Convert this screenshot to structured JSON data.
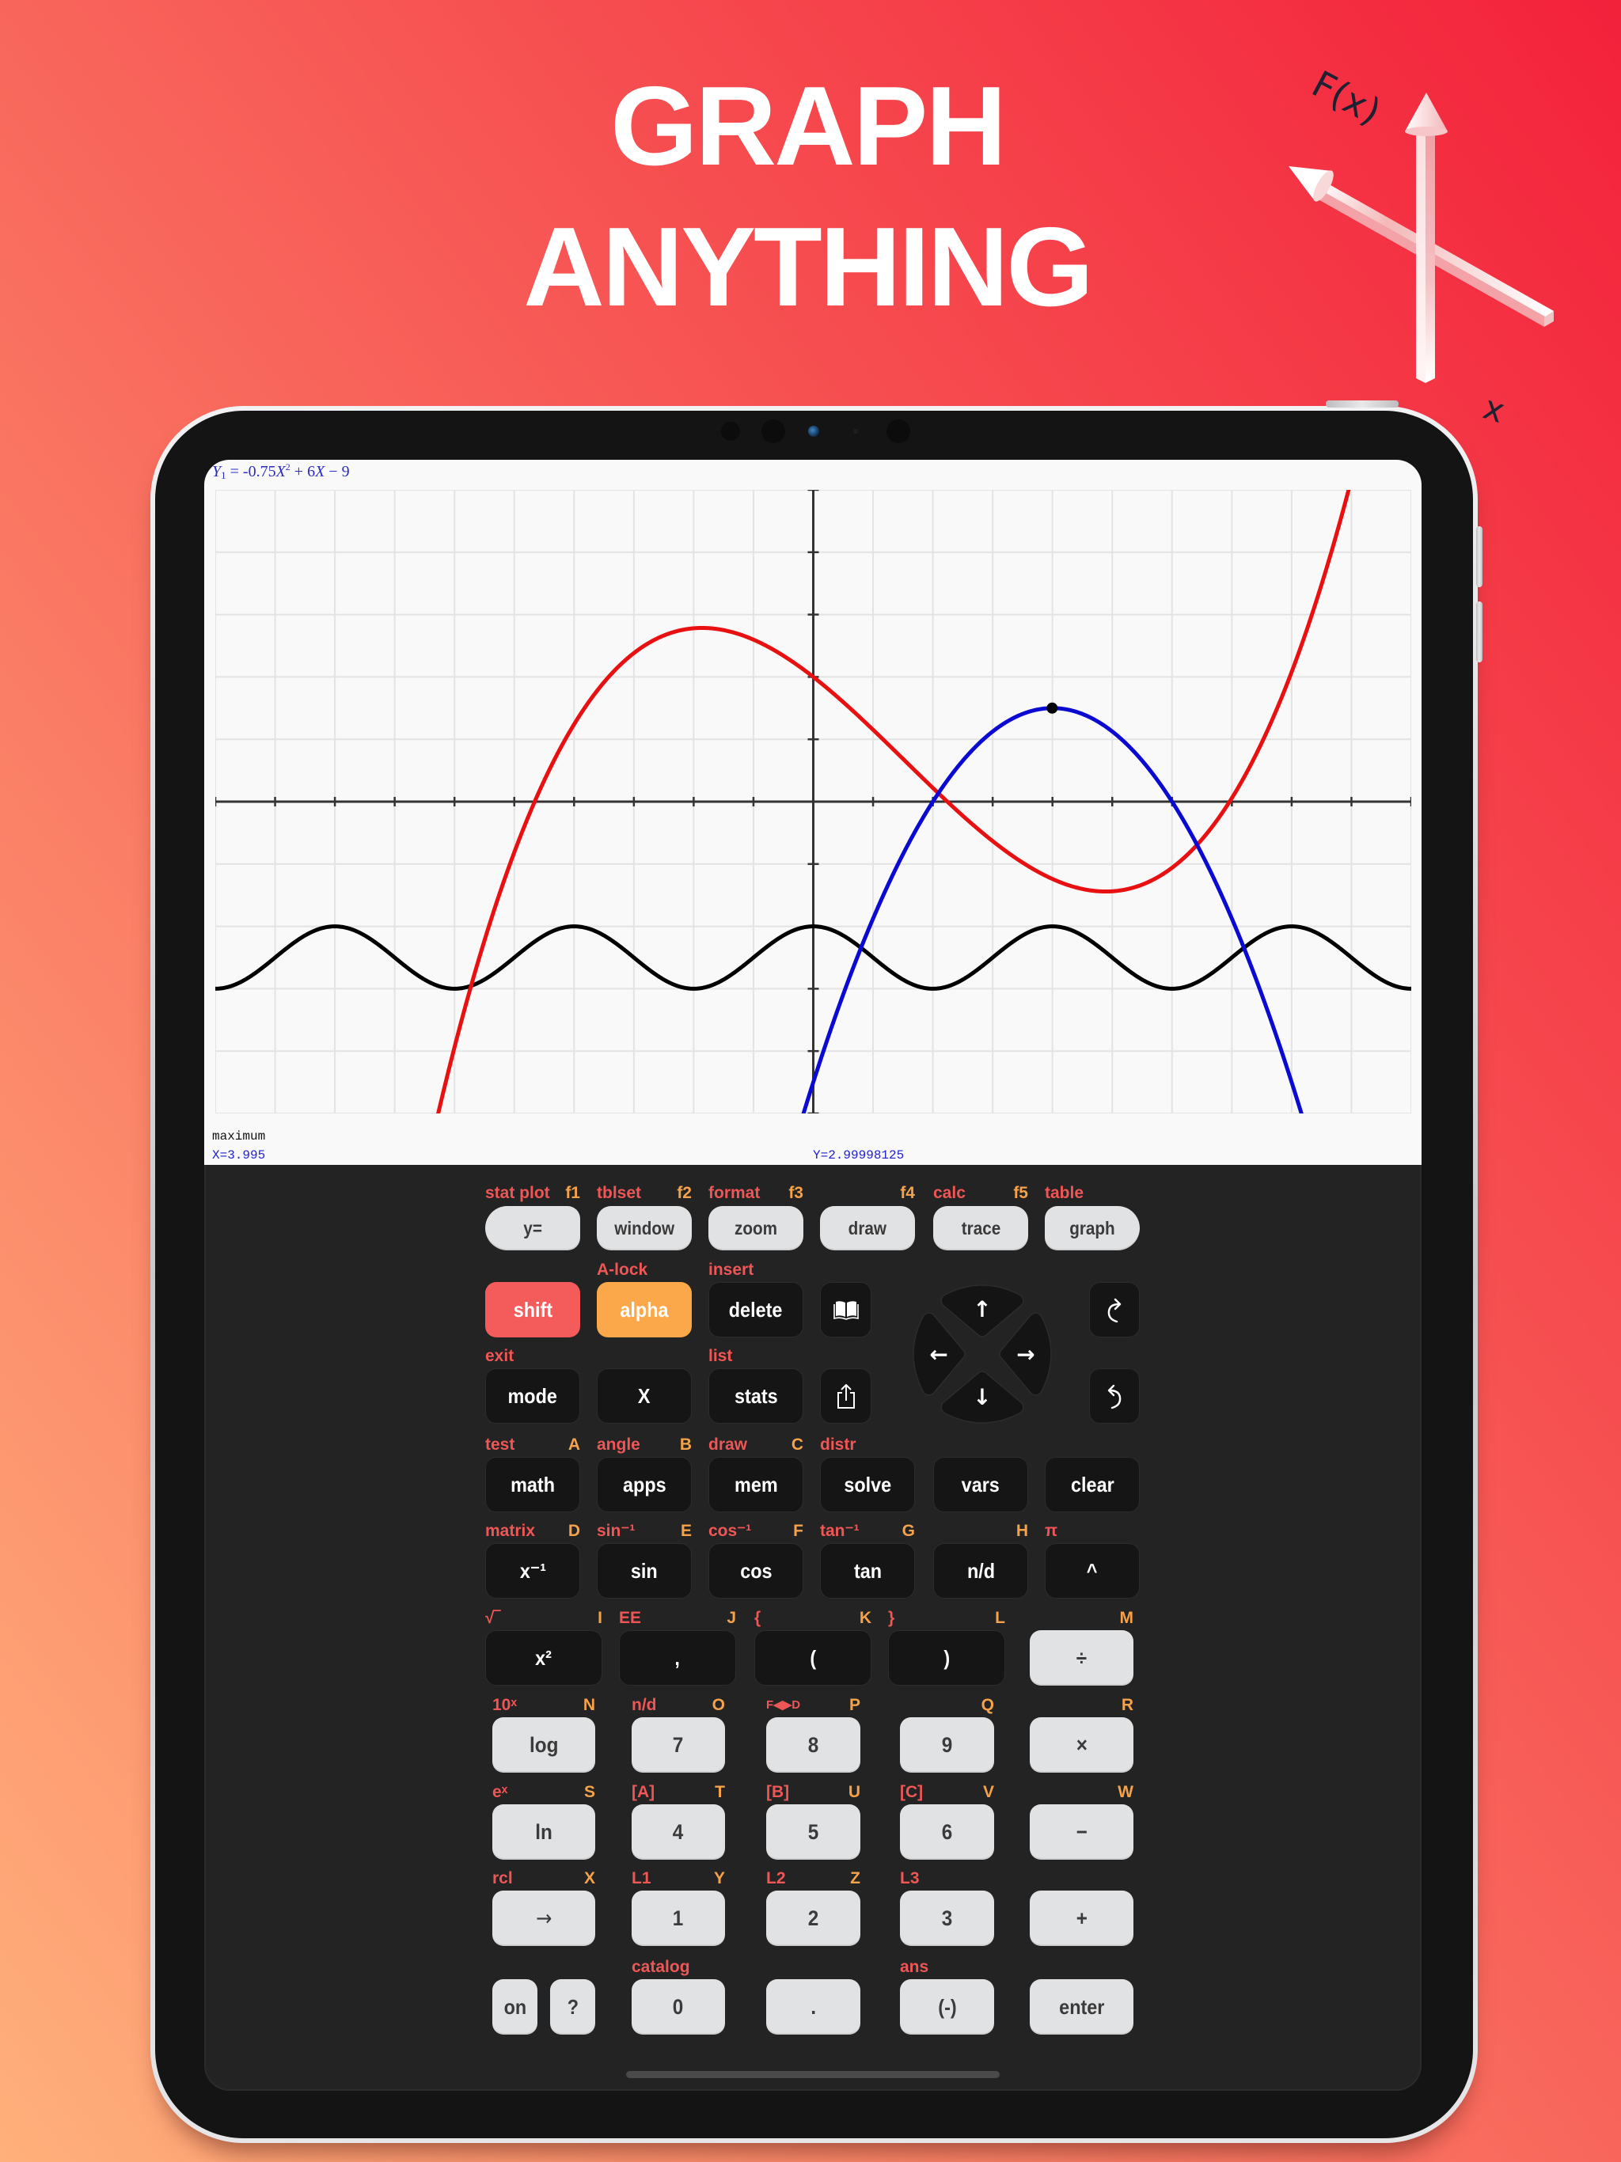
{
  "promo": {
    "title_line1": "GRAPH",
    "title_line2": "ANYTHING",
    "illustration_y_label": "F(x)",
    "illustration_x_label": "x"
  },
  "graph_screen": {
    "equation": {
      "lhs_var": "Y",
      "lhs_sub": "1",
      "eq_and_coeff": " = -0.75",
      "var_x": "X",
      "exponent": "2",
      "mid": " + 6",
      "tail": " − 9"
    },
    "status_label": "maximum",
    "x_readout": "X=3.995",
    "y_readout": "Y=2.99998125"
  },
  "chart_data": {
    "type": "line",
    "title": "",
    "xlabel": "",
    "ylabel": "",
    "xlim": [
      -10,
      10
    ],
    "ylim": [
      -10,
      10
    ],
    "x_grid_step": 1,
    "y_grid_step": 2,
    "x_tick_step": 1,
    "y_tick_step": 2,
    "grid": true,
    "tick_labels_shown": false,
    "legend": "none",
    "series": [
      {
        "id": "y1",
        "name": "Y1",
        "expression": "-0.75X^2 + 6X - 9",
        "kind": "polynomial",
        "coefficients": [
          -0.75,
          6,
          -9
        ],
        "color": "#0a0ad2"
      },
      {
        "id": "red",
        "name": "red curve",
        "estimated": true,
        "kind": "polynomial",
        "coefficients": [
          0.055,
          -0.25,
          -1.5,
          4
        ],
        "color": "#e81010"
      },
      {
        "id": "black",
        "name": "black curve",
        "estimated": true,
        "kind": "cosine",
        "amplitude": 1,
        "period": 4,
        "phase": 0,
        "offset": -5,
        "color": "#000000"
      }
    ],
    "highlighted_point": {
      "series": "y1",
      "label": "maximum",
      "x": 3.995,
      "y": 2.99998125
    }
  },
  "keypad": {
    "rows": [
      {
        "keys": [
          {
            "label": "y=",
            "shift": "stat plot",
            "alpha": "f1"
          },
          {
            "label": "window",
            "shift": "tblset",
            "alpha": "f2"
          },
          {
            "label": "zoom",
            "shift": "format",
            "alpha": "f3"
          },
          {
            "label": "draw",
            "shift": "",
            "alpha": "f4"
          },
          {
            "label": "trace",
            "shift": "calc",
            "alpha": "f5"
          },
          {
            "label": "graph",
            "shift": "table",
            "alpha": ""
          }
        ]
      },
      {
        "keys": [
          {
            "label": "shift",
            "shift": "",
            "alpha": ""
          },
          {
            "label": "alpha",
            "shift": "A-lock",
            "alpha": ""
          },
          {
            "label": "delete",
            "shift": "insert",
            "alpha": ""
          },
          {
            "icon": "book-icon"
          },
          {
            "icon": "redo-icon"
          }
        ]
      },
      {
        "keys": [
          {
            "label": "mode",
            "shift": "exit",
            "alpha": ""
          },
          {
            "label": "X",
            "shift": "",
            "alpha": ""
          },
          {
            "label": "stats",
            "shift": "list",
            "alpha": ""
          },
          {
            "icon": "share-icon"
          },
          {
            "icon": "undo-icon"
          }
        ]
      },
      {
        "keys": [
          {
            "label": "math",
            "shift": "test",
            "alpha": "A"
          },
          {
            "label": "apps",
            "shift": "angle",
            "alpha": "B"
          },
          {
            "label": "mem",
            "shift": "draw",
            "alpha": "C"
          },
          {
            "label": "solve",
            "shift": "distr",
            "alpha": ""
          },
          {
            "label": "vars",
            "shift": "",
            "alpha": ""
          },
          {
            "label": "clear",
            "shift": "",
            "alpha": ""
          }
        ]
      },
      {
        "keys": [
          {
            "label": "x⁻¹",
            "shift": "matrix",
            "alpha": "D"
          },
          {
            "label": "sin",
            "shift": "sin⁻¹",
            "alpha": "E"
          },
          {
            "label": "cos",
            "shift": "cos⁻¹",
            "alpha": "F"
          },
          {
            "label": "tan",
            "shift": "tan⁻¹",
            "alpha": "G"
          },
          {
            "label": "n/d",
            "shift": "",
            "alpha": "H"
          },
          {
            "label": "^",
            "shift": "π",
            "alpha": ""
          }
        ]
      },
      {
        "keys": [
          {
            "label": "x²",
            "shift": "√‾",
            "alpha": "I"
          },
          {
            "label": ",",
            "shift": "EE",
            "alpha": "J"
          },
          {
            "label": "(",
            "shift": "{",
            "alpha": "K"
          },
          {
            "label": ")",
            "shift": "}",
            "alpha": "L"
          },
          {
            "label": "÷",
            "shift": "",
            "alpha": "M"
          }
        ]
      },
      {
        "keys": [
          {
            "label": "log",
            "shift": "10ˣ",
            "alpha": "N"
          },
          {
            "label": "7",
            "shift": "n/d",
            "alpha": "O"
          },
          {
            "label": "8",
            "shift": "F◀▶D",
            "alpha": "P"
          },
          {
            "label": "9",
            "shift": "",
            "alpha": "Q"
          },
          {
            "label": "×",
            "shift": "",
            "alpha": "R"
          }
        ]
      },
      {
        "keys": [
          {
            "label": "ln",
            "shift": "eˣ",
            "alpha": "S"
          },
          {
            "label": "4",
            "shift": "[A]",
            "alpha": "T"
          },
          {
            "label": "5",
            "shift": "[B]",
            "alpha": "U"
          },
          {
            "label": "6",
            "shift": "[C]",
            "alpha": "V"
          },
          {
            "label": "−",
            "shift": "",
            "alpha": "W"
          }
        ]
      },
      {
        "keys": [
          {
            "label": "→",
            "shift": "rcl",
            "alpha": "X"
          },
          {
            "label": "1",
            "shift": "L1",
            "alpha": "Y"
          },
          {
            "label": "2",
            "shift": "L2",
            "alpha": "Z"
          },
          {
            "label": "3",
            "shift": "L3",
            "alpha": ""
          },
          {
            "label": "+",
            "shift": "",
            "alpha": ""
          }
        ]
      },
      {
        "keys": [
          {
            "label": "on",
            "shift": "",
            "alpha": ""
          },
          {
            "label": "?",
            "shift": "",
            "alpha": ""
          },
          {
            "label": "0",
            "shift": "catalog",
            "alpha": ""
          },
          {
            "label": ".",
            "shift": "",
            "alpha": ""
          },
          {
            "label": "(-)",
            "shift": "ans",
            "alpha": ""
          },
          {
            "label": "enter",
            "shift": "",
            "alpha": ""
          }
        ]
      }
    ],
    "dpad": {
      "up": "↑",
      "down": "↓",
      "left": "←",
      "right": "→"
    }
  },
  "colors": {
    "shift_label": "#ef5656",
    "alpha_label": "#f5a24a",
    "shift_key": "#f45b5b",
    "alpha_key": "#fba84a",
    "equation_text": "#2b2bc4",
    "readout_text": "#1f1fcf"
  }
}
